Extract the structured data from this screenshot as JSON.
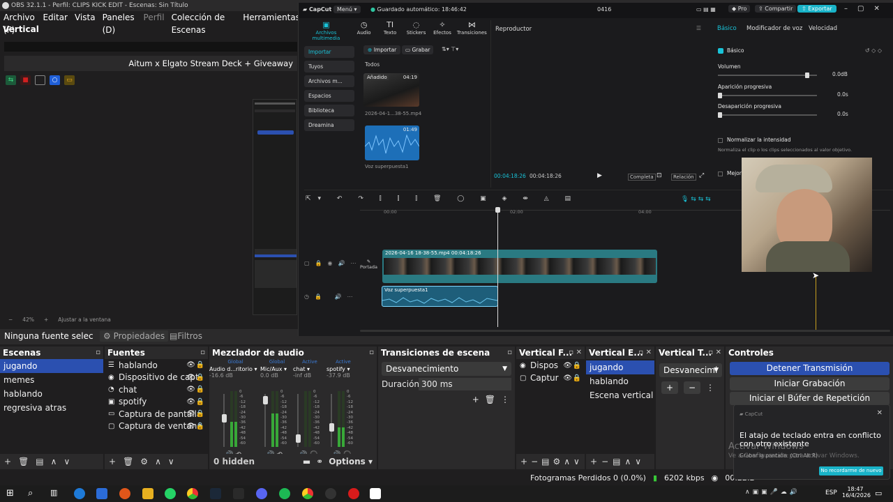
{
  "obs": {
    "window_title": "OBS 32.1.1 - Perfil: CLIPS KICK EDIT - Escenas: Sin Título",
    "menu": [
      "Archivo (F)",
      "Editar",
      "Vista",
      "Paneles (D)",
      "Perfil",
      "Colección de Escenas",
      "Herramientas"
    ],
    "canvas_label": "Vertical",
    "banner": "Aitum x Elgato Stream Deck + Giveaway",
    "zoom": "42%",
    "fit_label": "Ajustar a la ventana",
    "no_source": "Ninguna fuente selec",
    "properties_label": "Propiedades",
    "filters_label": "Filtros",
    "scenes": {
      "title": "Escenas",
      "items": [
        "jugando",
        "memes",
        "hablando",
        "regresiva atras"
      ],
      "selected": "jugando"
    },
    "sources": {
      "title": "Fuentes",
      "items": [
        {
          "icon": "list-icon",
          "label": "hablando"
        },
        {
          "icon": "camera-icon",
          "label": "Dispositivo de capt"
        },
        {
          "icon": "chat-icon",
          "label": "chat"
        },
        {
          "icon": "window-icon",
          "label": "spotify"
        },
        {
          "icon": "monitor-icon",
          "label": "Captura de pantalla"
        },
        {
          "icon": "window-icon",
          "label": "Captura de ventana"
        }
      ]
    },
    "mixer": {
      "title": "Mezclador de audio",
      "hidden_label": "0 hidden",
      "options_label": "Options",
      "channels": [
        {
          "tag": "Global",
          "name": "Audio d...ritorio",
          "db": "-16.6 dB",
          "level": 0.45,
          "fader": 0.55
        },
        {
          "tag": "Global",
          "name": "Mic/Aux",
          "db": "0.0 dB",
          "level": 0.6,
          "fader": 0.95
        },
        {
          "tag": "Active",
          "name": "chat",
          "db": "-inf dB",
          "level": 0.0,
          "fader": 0.1
        },
        {
          "tag": "Active",
          "name": "spotify",
          "db": "-37.9 dB",
          "level": 0.35,
          "fader": 0.35
        }
      ],
      "scale": [
        "0",
        "-6",
        "-12",
        "-18",
        "-24",
        "-30",
        "-36",
        "-42",
        "-48",
        "-54",
        "-60"
      ]
    },
    "transitions": {
      "title": "Transiciones de escena",
      "selected": "Desvanecimiento",
      "duration_label": "Duración",
      "duration": "300 ms"
    },
    "vertical_sources": {
      "title": "Vertical F...",
      "items": [
        "Dispos",
        "Captur"
      ]
    },
    "vertical_scenes": {
      "title": "Vertical E...",
      "items": [
        "jugando",
        "hablando",
        "Escena vertical"
      ],
      "selected": "jugando"
    },
    "vertical_transitions": {
      "title": "Vertical T...",
      "selected": "Desvanecimi"
    },
    "controls": {
      "title": "Controles",
      "buttons": [
        "Detener Transmisión",
        "Iniciar Grabación",
        "Iniciar el Búfer de Repetición"
      ]
    },
    "status": {
      "dropped": "Fotogramas Perdidos 0 (0.0%)",
      "bitrate": "6202 kbps",
      "time": "00:22:2"
    }
  },
  "capcut": {
    "app_name": "CapCut",
    "menu_label": "Menú",
    "autosave": "Guardado automático: 18:46:42",
    "project": "0416",
    "pro_label": "Pro",
    "share_label": "Compartir",
    "export_label": "Exportar",
    "tabs": [
      "Archivos multimedia",
      "Audio",
      "Texto",
      "Stickers",
      "Efectos",
      "Transiciones"
    ],
    "side": [
      "Importar",
      "Tuyos",
      "Archivos m...",
      "Espacios",
      "Biblioteca",
      "Dreamina"
    ],
    "import_btn": "Importar",
    "record_btn": "Grabar",
    "all_label": "Todos",
    "clip1": {
      "badge": "Añadido",
      "duration": "04:19",
      "name": "2026-04-1...38-55.mp4"
    },
    "clip2": {
      "duration": "01:49",
      "name": "Voz superpuesta1"
    },
    "player_title": "Reproductor",
    "time_current": "00:04:18:26",
    "time_total": "00:04:18:26",
    "complete_label": "Completa",
    "ratio_label": "Relación",
    "right_tabs": [
      "Básico",
      "Modificador de voz",
      "Velocidad"
    ],
    "basic_label": "Básico",
    "volume": {
      "label": "Volumen",
      "value": "0.0dB",
      "level": 0.92
    },
    "fade_in": {
      "label": "Aparición progresiva",
      "value": "0.0s"
    },
    "fade_out": {
      "label": "Desaparición progresiva",
      "value": "0.0s"
    },
    "normalize": {
      "label": "Normalizar la intensidad",
      "desc": "Normaliza el clip o los clips seleccionados al valor objetivo."
    },
    "improve_label": "Mejora",
    "ruler": [
      "00:00",
      "02:00",
      "04:00"
    ],
    "video_track": {
      "name": "2026-04-16 18-38-55.mp4",
      "duration": "00:04:18:26"
    },
    "audio_track": {
      "name": "Voz superpuesta1"
    },
    "cover_label": "Portada"
  },
  "toast": {
    "app": "CapCut",
    "message": "El atajo de teclado entra en conflicto con otro existente",
    "sub": "Grabar la pantalla: (Ctrl Alt R)",
    "button": "No recordarme de nuevo",
    "watermark_title": "Activar Windows",
    "watermark_sub": "Ve a Configuración para activar Windows."
  },
  "taskbar": {
    "lang": "ESP",
    "time": "18:47",
    "date": "16/4/2026"
  }
}
